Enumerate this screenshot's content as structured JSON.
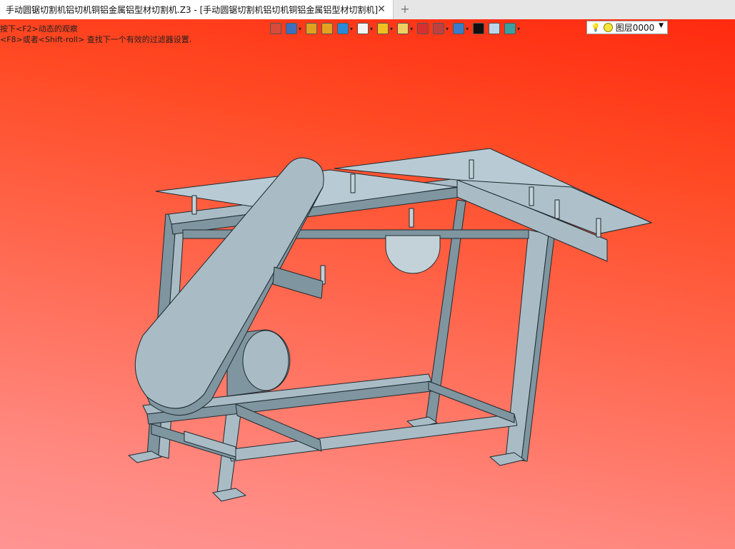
{
  "tab": {
    "title": "手动圆锯切割机铝切机铜铝金属铝型材切割机.Z3 - [手动圆锯切割机铝切机铜铝金属铝型材切割机]",
    "close_glyph": "✕",
    "new_tab_glyph": "+"
  },
  "viewport": {
    "hints": [
      "按下<F2>动态的观察",
      "<F8>或者<Shift-roll> 查找下一个有效的过滤器设置."
    ]
  },
  "toolbar": {
    "icons": [
      {
        "name": "exit-icon",
        "color": "#d84a3a",
        "dropdown": false
      },
      {
        "name": "view-orient-icon",
        "color": "#3d6fbf",
        "dropdown": true
      },
      {
        "name": "pen-icon",
        "color": "#e0a020",
        "dropdown": false
      },
      {
        "name": "shaded-cube-icon",
        "color": "#e8a020",
        "dropdown": false
      },
      {
        "name": "solid-cube-icon",
        "color": "#2a8ad8",
        "dropdown": true
      },
      {
        "name": "white-cube-icon",
        "color": "#f4f4f4",
        "dropdown": true
      },
      {
        "name": "render-icon",
        "color": "#f0c020",
        "dropdown": true
      },
      {
        "name": "zoom-icon",
        "color": "#f0d060",
        "dropdown": true
      },
      {
        "name": "snap-icon",
        "color": "#d83030",
        "dropdown": false
      },
      {
        "name": "dimension-icon",
        "color": "#c04040",
        "dropdown": true
      },
      {
        "name": "display-icon",
        "color": "#3a7cc8",
        "dropdown": true
      },
      {
        "name": "line-color-icon",
        "color": "#111111",
        "dropdown": false
      },
      {
        "name": "face-color-icon",
        "color": "#bcd6ec",
        "dropdown": false
      },
      {
        "name": "layer-stack-icon",
        "color": "#3aa0a0",
        "dropdown": true
      }
    ],
    "layer": {
      "label": "图层0000"
    }
  },
  "colors": {
    "steel": "#a9bcc6",
    "steel_dark": "#7f959f",
    "steel_light": "#c3d2d9",
    "edge": "#1e2a30"
  }
}
